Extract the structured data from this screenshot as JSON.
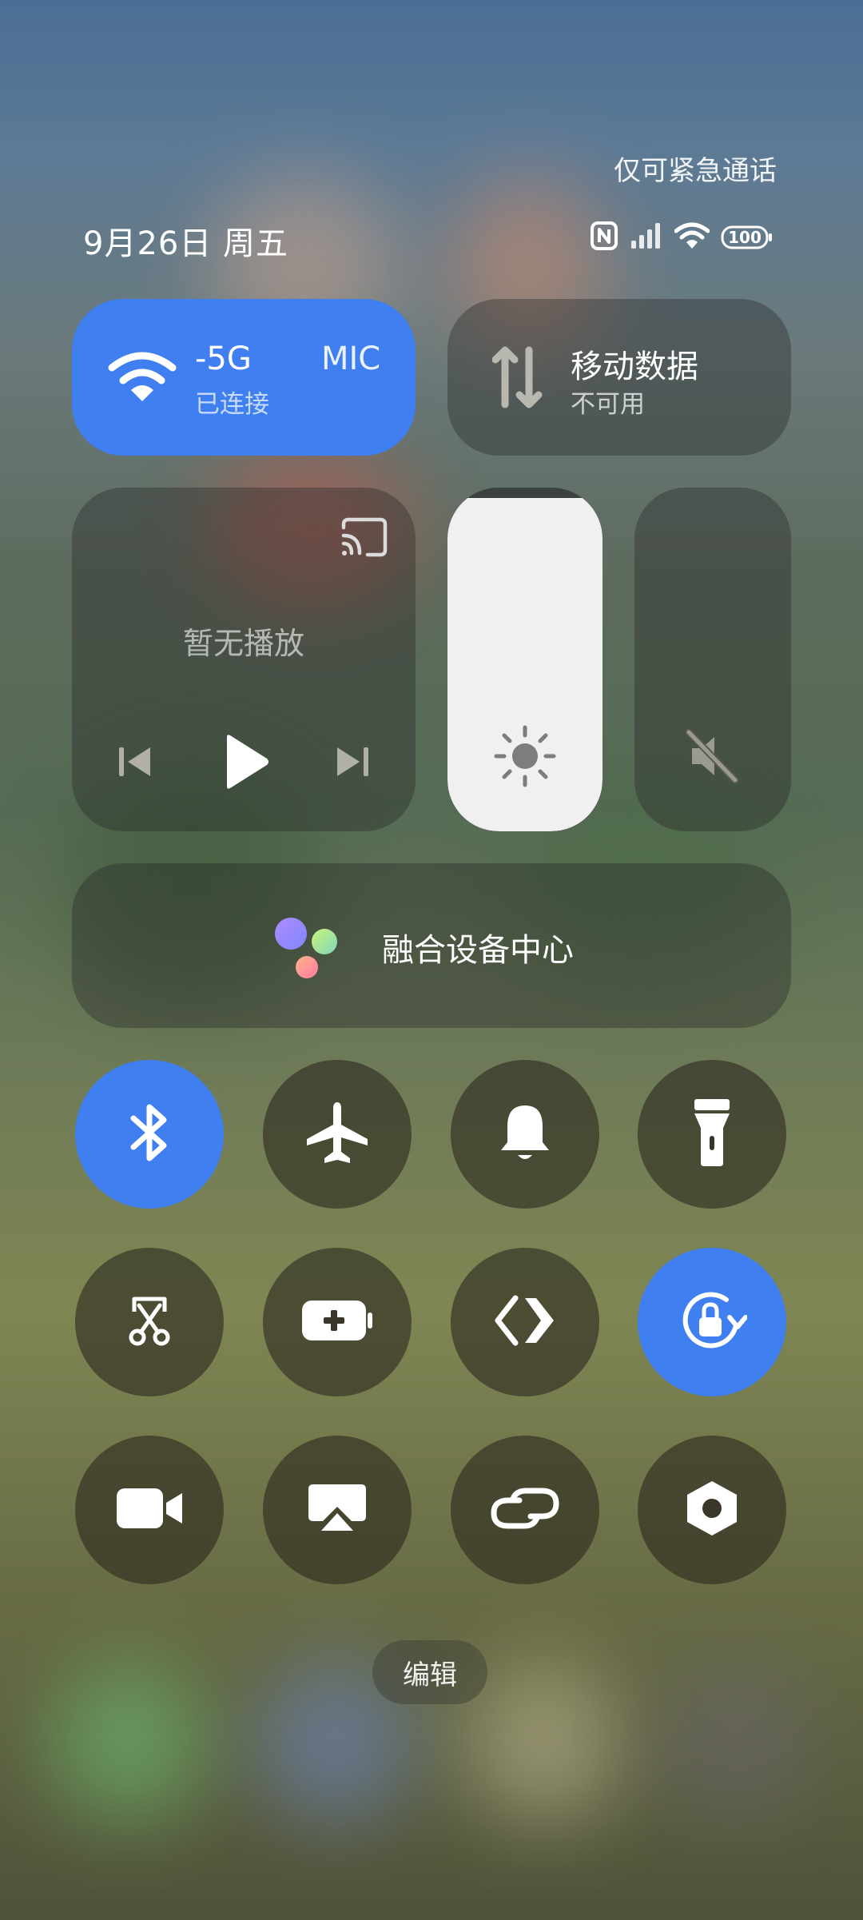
{
  "status": {
    "emergency_text": "仅可紧急通话",
    "date_text": "9月26日 周五",
    "battery_level": "100"
  },
  "wifi_tile": {
    "network_name": "-5G",
    "network_name_tail": "MIC",
    "status": "已连接"
  },
  "mobile_data_tile": {
    "title": "移动数据",
    "status": "不可用"
  },
  "media": {
    "placeholder": "暂无播放"
  },
  "brightness": {
    "level": 0.97
  },
  "volume": {
    "level": 0.0
  },
  "device_center": {
    "label": "融合设备中心"
  },
  "toggles": [
    {
      "icon": "bluetooth-icon",
      "active": true
    },
    {
      "icon": "airplane-icon",
      "active": false
    },
    {
      "icon": "bell-icon",
      "active": false
    },
    {
      "icon": "flashlight-icon",
      "active": false
    },
    {
      "icon": "screenshot-icon",
      "active": false
    },
    {
      "icon": "battery-saver-icon",
      "active": false
    },
    {
      "icon": "nearby-share-icon",
      "active": false
    },
    {
      "icon": "rotation-lock-icon",
      "active": true
    },
    {
      "icon": "screen-record-icon",
      "active": false
    },
    {
      "icon": "cast-screen-icon",
      "active": false
    },
    {
      "icon": "link-icon",
      "active": false
    },
    {
      "icon": "settings-hex-icon",
      "active": false
    }
  ],
  "edit": {
    "label": "编辑"
  },
  "colors": {
    "accent": "#3f7ff0",
    "tile_bg": "rgba(40,40,40,0.38)"
  }
}
